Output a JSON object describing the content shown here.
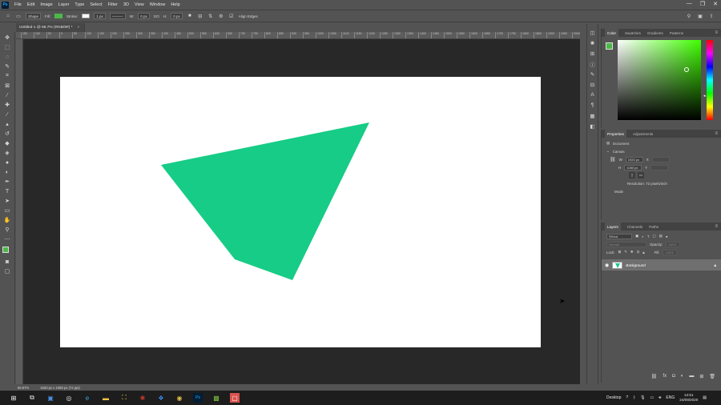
{
  "menubar": {
    "logo": "Ps",
    "items": [
      "File",
      "Edit",
      "Image",
      "Layer",
      "Type",
      "Select",
      "Filter",
      "3D",
      "View",
      "Window",
      "Help"
    ],
    "window_controls": [
      "—",
      "❐",
      "✕"
    ]
  },
  "options": {
    "mode": "Shape",
    "fill_label": "Fill:",
    "fill_color": "#4cb848",
    "stroke_label": "Stroke:",
    "stroke_width": "1 px",
    "w_label": "W:",
    "w_value": "0 px",
    "link_label": "GO",
    "h_label": "H:",
    "h_value": "0 px",
    "align_edges": "Align Edges",
    "right_icons": [
      "search-icon",
      "workspace-icon",
      "share-icon"
    ]
  },
  "document": {
    "tab_title": "Untitled-1 @ 66.7% (RGB/8#) *",
    "tab_close": "×",
    "bg_color": "#ffffff",
    "shape_color": "#17cc86"
  },
  "ruler": {
    "ticks": [
      "150",
      "100",
      "50",
      "0",
      "50",
      "100",
      "150",
      "200",
      "250",
      "300",
      "350",
      "400",
      "450",
      "500",
      "550",
      "600",
      "650",
      "700",
      "750",
      "800",
      "850",
      "900",
      "950",
      "1000",
      "1050",
      "1100",
      "1150",
      "1200",
      "1250",
      "1300",
      "1350",
      "1400",
      "1450",
      "1500",
      "1550",
      "1600",
      "1650",
      "1700",
      "1750",
      "1800",
      "1850",
      "1900",
      "1950",
      "2000"
    ]
  },
  "status": {
    "zoom": "66.67%",
    "doc_info": "1920 px x 1080 px (72 ppi)"
  },
  "color_panel": {
    "tabs": [
      "Color",
      "Swatches",
      "Gradients",
      "Patterns"
    ],
    "foreground": "#4cb848",
    "background": "#ffffff"
  },
  "properties_panel": {
    "tabs": [
      "Properties",
      "Adjustments"
    ],
    "doc_label": "Document",
    "canvas_label": "Canvas",
    "w_label": "W",
    "w_value": "1920 px",
    "x_label": "X",
    "h_label": "H",
    "h_value": "1080 px",
    "y_label": "Y",
    "resolution": "Resolution: 72 pixels/inch",
    "mode_label": "Mode"
  },
  "layers_panel": {
    "tabs": [
      "Layers",
      "Channels",
      "Paths"
    ],
    "kind_label": "Kind",
    "blend_mode": "Normal",
    "opacity_label": "Opacity:",
    "opacity_value": "100%",
    "lock_label": "Lock:",
    "fill_label": "Fill:",
    "fill_value": "100%",
    "layer_name": "Background"
  },
  "taskbar": {
    "desktop_label": "Desktop",
    "lang": "ENG",
    "time": "12:51",
    "date": "24/09/2020"
  }
}
